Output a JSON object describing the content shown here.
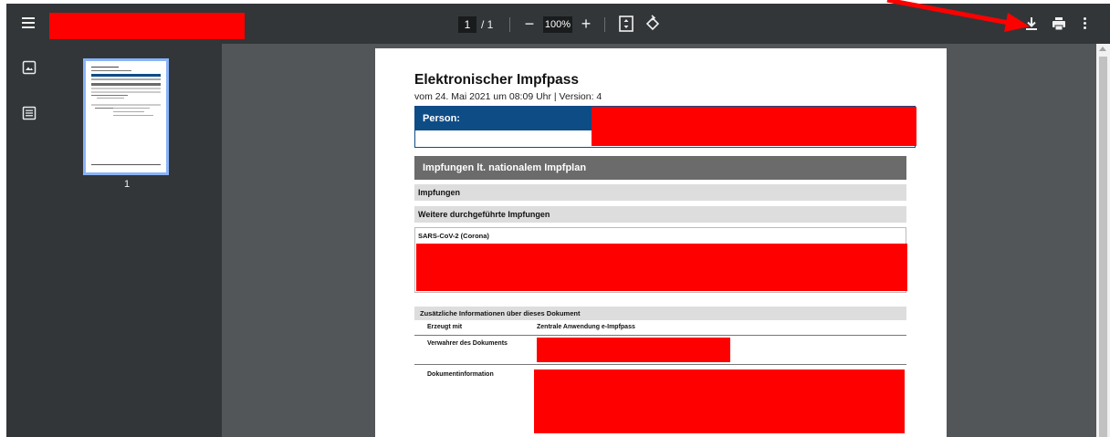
{
  "toolbar": {
    "page_current": "1",
    "page_total_sep": "/  1",
    "zoom": "100%",
    "zoom_minus": "−",
    "zoom_plus": "+",
    "icons": [
      "menu-icon",
      "fit-page-icon",
      "rotate-icon",
      "download-icon",
      "print-icon",
      "more-icon"
    ]
  },
  "sidebar": {
    "thumbnail_page_number": "1",
    "icons": [
      "thumbnail-view-icon",
      "outline-view-icon"
    ]
  },
  "document": {
    "title": "Elektronischer Impfpass",
    "subtitle": "vom 24. Mai 2021 um 08:09 Uhr | Version: 4",
    "person_label": "Person:",
    "section_impfplan": "Impfungen lt. nationalem Impfplan",
    "section_impfungen": "Impfungen",
    "section_weitere": "Weitere durchgeführte Impfungen",
    "corona_label": "SARS-CoV-2 (Corona)",
    "info_header": "Zusätzliche Informationen über dieses Dokument",
    "rows": [
      {
        "key": "Erzeugt mit",
        "value": "Zentrale Anwendung e-Impfpass"
      },
      {
        "key": "Verwahrer des Dokuments",
        "value": ""
      },
      {
        "key": "Dokumentinformation",
        "value": ""
      }
    ]
  },
  "colors": {
    "toolbar_bg": "#323639",
    "viewer_bg": "#525659",
    "redaction": "#ff0000",
    "annotation_arrow": "#ff0000",
    "person_header": "#0e4c86",
    "section_header": "#6b6b6b",
    "thumbnail_border": "#8ab4f8"
  }
}
